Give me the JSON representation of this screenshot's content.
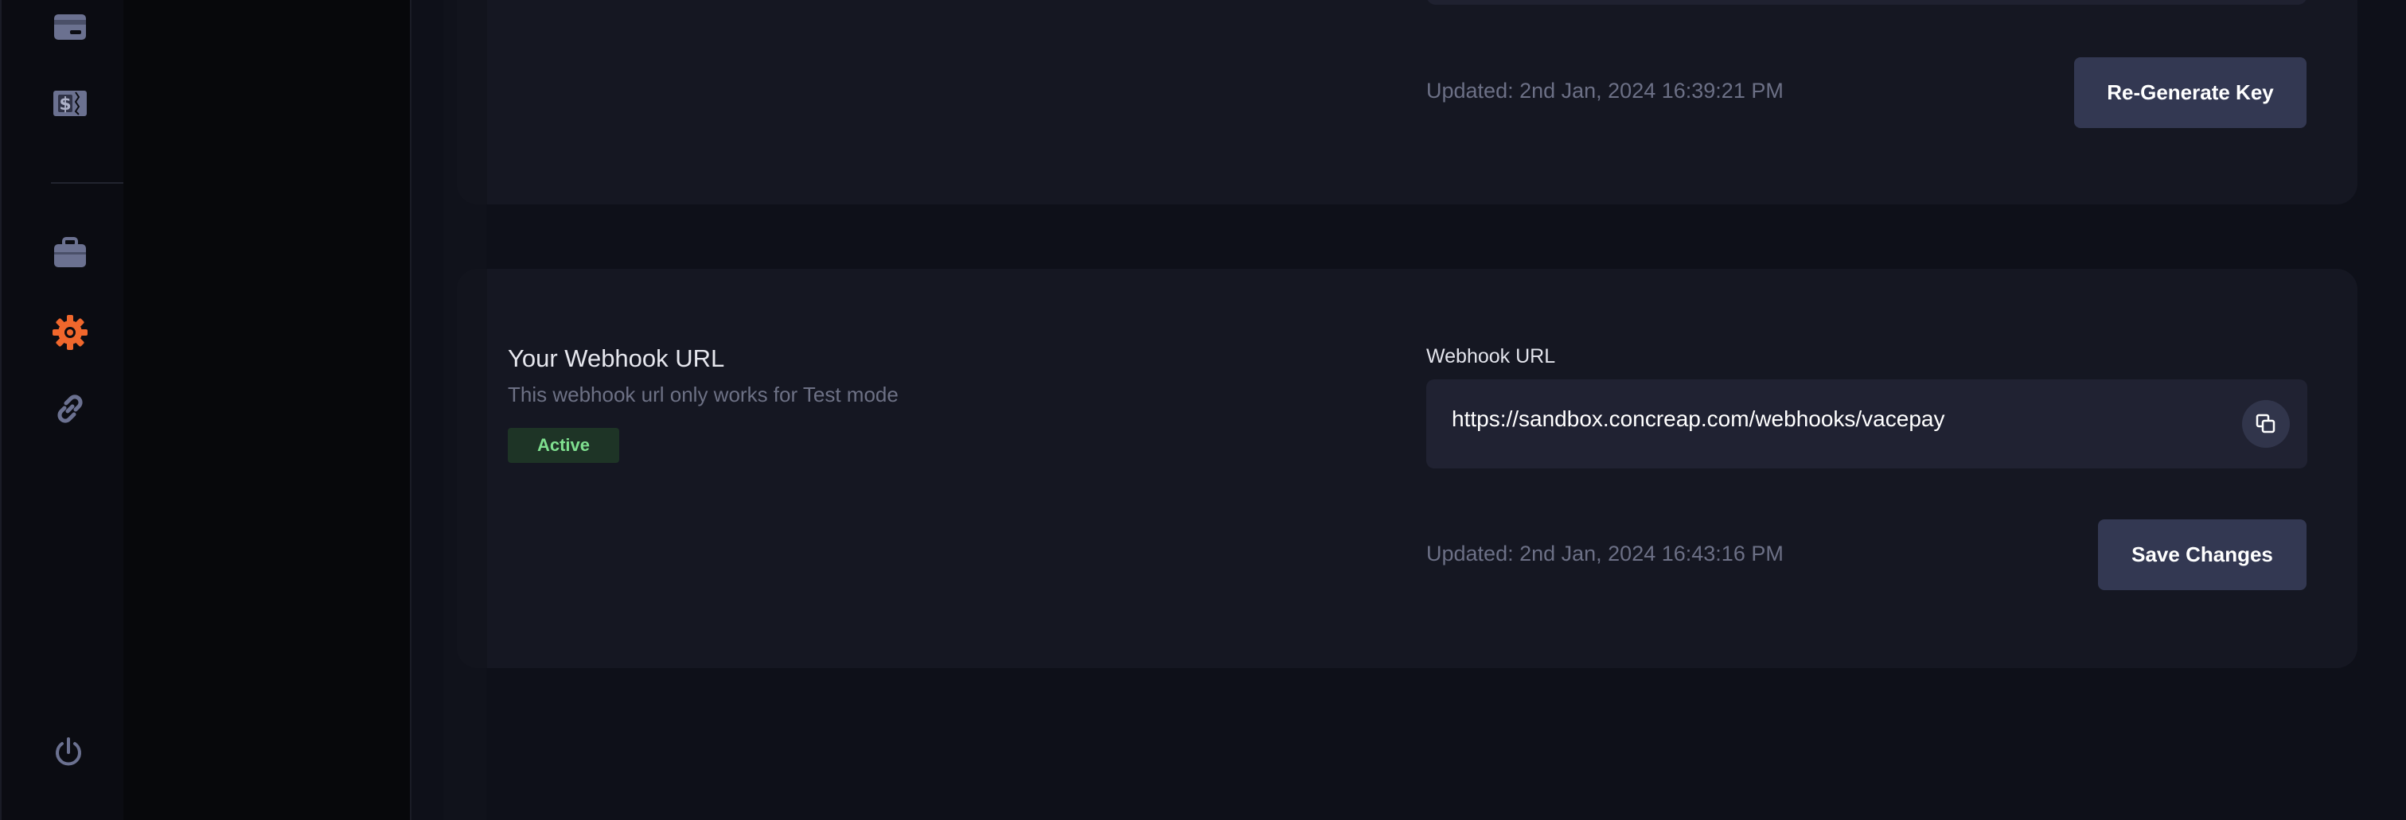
{
  "icons": {
    "card": "credit-card-icon",
    "bill": "dollar-bill-icon",
    "briefcase": "briefcase-icon",
    "settings": "gear-icon",
    "link": "link-icon",
    "power": "power-icon",
    "copy": "copy-icon"
  },
  "colors": {
    "accent": "#f0672c",
    "rail_icon": "#6b7190",
    "button_bg": "#333852",
    "badge_bg": "#1e3426",
    "badge_text": "#7fe08f"
  },
  "api_key_section": {
    "updated_text": "Updated: 2nd Jan, 2024 16:39:21 PM",
    "regenerate_label": "Re-Generate Key"
  },
  "webhook_section": {
    "title": "Your Webhook URL",
    "subtitle": "This webhook url only works for Test mode",
    "status_badge": "Active",
    "field_label": "Webhook URL",
    "url_value": "https://sandbox.concreap.com/webhooks/vacepay",
    "updated_text": "Updated: 2nd Jan, 2024 16:43:16 PM",
    "save_label": "Save Changes"
  }
}
